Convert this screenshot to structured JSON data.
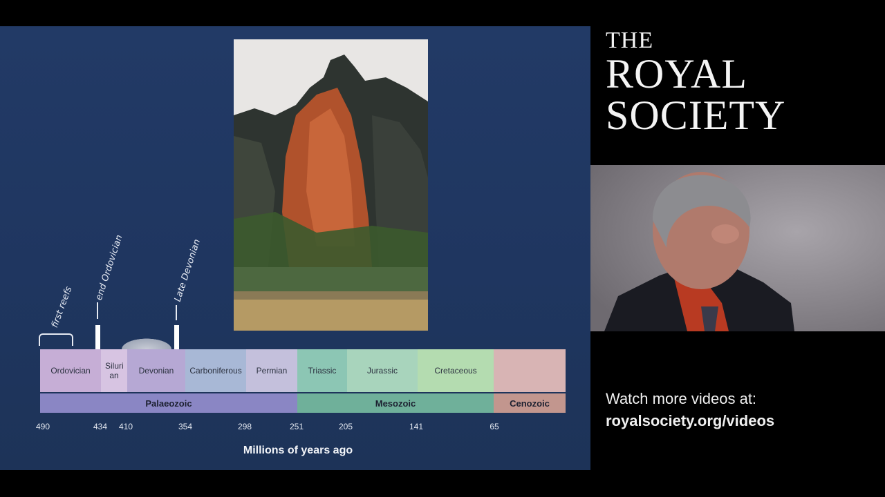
{
  "slide": {
    "annotations": {
      "first_reefs": "first reefs",
      "end_ordovician": "end Ordovician",
      "late_devonian": "Late Devonian"
    },
    "periods": [
      {
        "name": "Ordovician",
        "color": "#c6aed6"
      },
      {
        "name": "Siluri an",
        "color": "#d7c4e2"
      },
      {
        "name": "Devonian",
        "color": "#b6a8d4"
      },
      {
        "name": "Carboniferous",
        "color": "#a8b8d6"
      },
      {
        "name": "Permian",
        "color": "#c4c0dc"
      },
      {
        "name": "Triassic",
        "color": "#8cc6b4"
      },
      {
        "name": "Jurassic",
        "color": "#a8d4bc"
      },
      {
        "name": "Cretaceous",
        "color": "#b4dcb0"
      },
      {
        "name": "",
        "color": "#d8b4b4"
      }
    ],
    "eras": [
      {
        "name": "Palaeozoic",
        "color": "#8a86c4"
      },
      {
        "name": "Mesozoic",
        "color": "#6fb09a"
      },
      {
        "name": "Cenozoic",
        "color": "#c2968e"
      }
    ],
    "ticks": [
      "490",
      "434",
      "410",
      "354",
      "298",
      "251",
      "205",
      "141",
      "65"
    ],
    "axis_title": "Millions of years ago"
  },
  "brand": {
    "line1": "THE",
    "line2": "ROYAL",
    "line3": "SOCIETY"
  },
  "footer": {
    "watch_text": "Watch more videos at:",
    "url": "royalsociety.org/videos"
  }
}
